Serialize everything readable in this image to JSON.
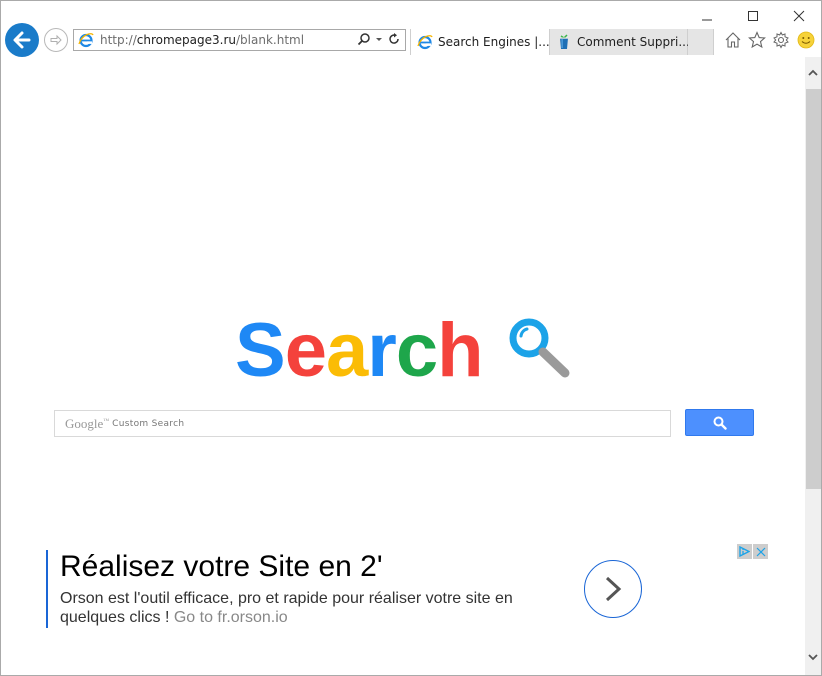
{
  "window": {
    "caption_buttons": {
      "minimize": "minimize-icon",
      "maximize": "maximize-icon",
      "close": "close-icon"
    }
  },
  "nav": {
    "back": "back-arrow-icon",
    "forward": "forward-arrow-icon",
    "address": {
      "prefix": "http://",
      "domain": "chromepage3.ru",
      "path": "/blank.html",
      "site_icon": "ie-icon"
    },
    "address_tools": [
      "search-icon",
      "dropdown-icon",
      "refresh-icon"
    ]
  },
  "tabs": [
    {
      "label": "Search Engines |...",
      "icon": "ie-icon",
      "active": true,
      "close": "×"
    },
    {
      "label": "Comment Suppri...",
      "icon": "recycle-bin-icon",
      "active": false
    }
  ],
  "commands": [
    "home-icon",
    "favorites-star-icon",
    "settings-gear-icon",
    "feedback-smiley-icon"
  ],
  "page": {
    "logo": {
      "letters": [
        {
          "char": "S",
          "color": "#1e88f5"
        },
        {
          "char": "e",
          "color": "#f4423c"
        },
        {
          "char": "a",
          "color": "#fbbc05"
        },
        {
          "char": "r",
          "color": "#1e88f5"
        },
        {
          "char": "c",
          "color": "#1ea64b"
        },
        {
          "char": "h",
          "color": "#f4423c"
        }
      ],
      "magnifier_color": "#1ca3e8"
    },
    "search": {
      "brand": "Google",
      "tm": "™",
      "placeholder": "Custom Search",
      "button_icon": "search-icon",
      "button_color": "#4d90fe"
    },
    "ad": {
      "title": "Réalisez votre Site en 2'",
      "body": "Orson est l'outil efficace, pro et rapide pour réaliser votre site en quelques clics !",
      "link": "Go to fr.orson.io",
      "accent_color": "#1a66d6",
      "arrow": "chevron-right-icon",
      "adchoices": [
        "adchoices-icon",
        "close-ad-icon"
      ]
    }
  },
  "scrollbar": {
    "position_fraction": 0.0,
    "visible_fraction": 0.72
  }
}
